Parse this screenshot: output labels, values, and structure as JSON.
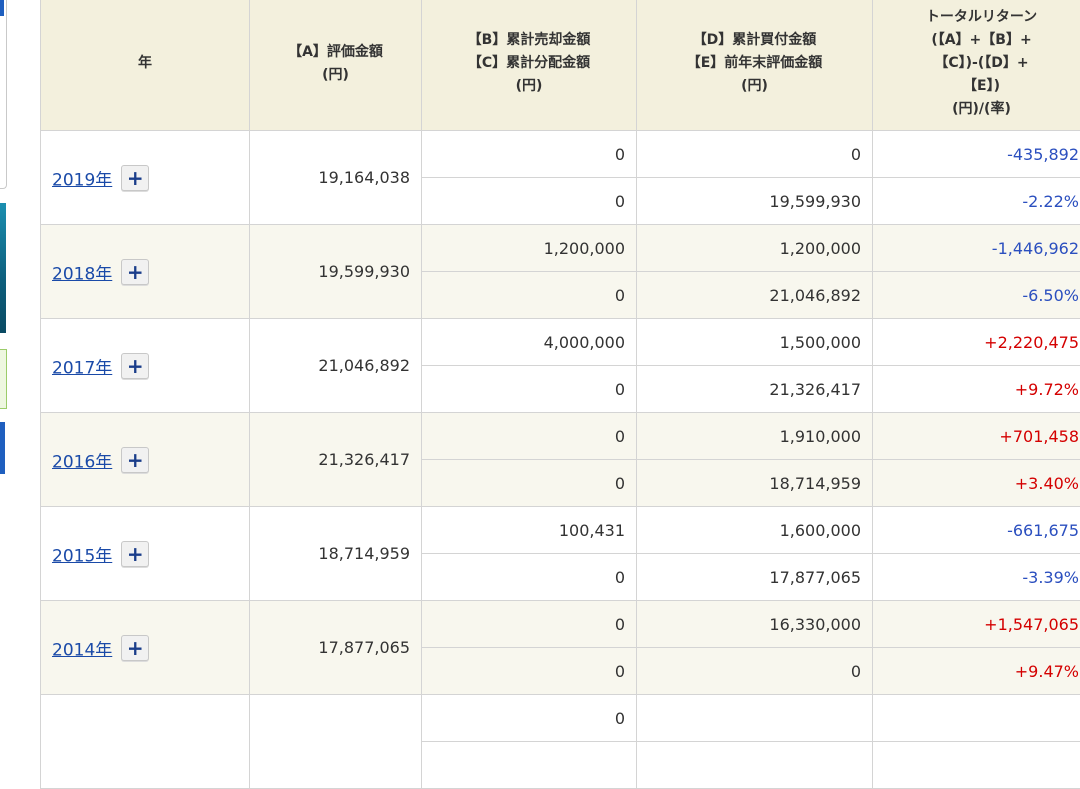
{
  "headers": {
    "year": "年",
    "valuation": [
      "【A】評価金額",
      "(円)"
    ],
    "sold_dist": [
      "【B】累計売却金額",
      "【C】累計分配金額",
      "(円)"
    ],
    "bought_prev": [
      "【D】累計買付金額",
      "【E】前年末評価金額",
      "(円)"
    ],
    "total_return": [
      "トータルリターン",
      "(【A】+【B】+",
      "【C】)-(【D】+",
      "【E】)",
      "(円)/(率)"
    ]
  },
  "expand_label": "+",
  "rows": [
    {
      "year": "2019年",
      "valuation": "19,164,038",
      "sold": "0",
      "distribution": "0",
      "bought": "0",
      "prev_value": "19,599,930",
      "return_amount": "-435,892",
      "return_rate": "-2.22%",
      "sign": "neg"
    },
    {
      "year": "2018年",
      "valuation": "19,599,930",
      "sold": "1,200,000",
      "distribution": "0",
      "bought": "1,200,000",
      "prev_value": "21,046,892",
      "return_amount": "-1,446,962",
      "return_rate": "-6.50%",
      "sign": "neg"
    },
    {
      "year": "2017年",
      "valuation": "21,046,892",
      "sold": "4,000,000",
      "distribution": "0",
      "bought": "1,500,000",
      "prev_value": "21,326,417",
      "return_amount": "+2,220,475",
      "return_rate": "+9.72%",
      "sign": "pos"
    },
    {
      "year": "2016年",
      "valuation": "21,326,417",
      "sold": "0",
      "distribution": "0",
      "bought": "1,910,000",
      "prev_value": "18,714,959",
      "return_amount": "+701,458",
      "return_rate": "+3.40%",
      "sign": "pos"
    },
    {
      "year": "2015年",
      "valuation": "18,714,959",
      "sold": "100,431",
      "distribution": "0",
      "bought": "1,600,000",
      "prev_value": "17,877,065",
      "return_amount": "-661,675",
      "return_rate": "-3.39%",
      "sign": "neg"
    },
    {
      "year": "2014年",
      "valuation": "17,877,065",
      "sold": "0",
      "distribution": "0",
      "bought": "16,330,000",
      "prev_value": "0",
      "return_amount": "+1,547,065",
      "return_rate": "+9.47%",
      "sign": "pos"
    },
    {
      "year": "",
      "valuation": "",
      "sold": "0",
      "distribution": "",
      "bought": "",
      "prev_value": "",
      "return_amount": "",
      "return_rate": "",
      "sign": "pos"
    }
  ],
  "colors": {
    "negative": "#2b4fbf",
    "positive": "#d40000",
    "header_bg": "#f3f0dd",
    "alt_row_bg": "#f8f7ee",
    "link": "#1a4aa8"
  }
}
